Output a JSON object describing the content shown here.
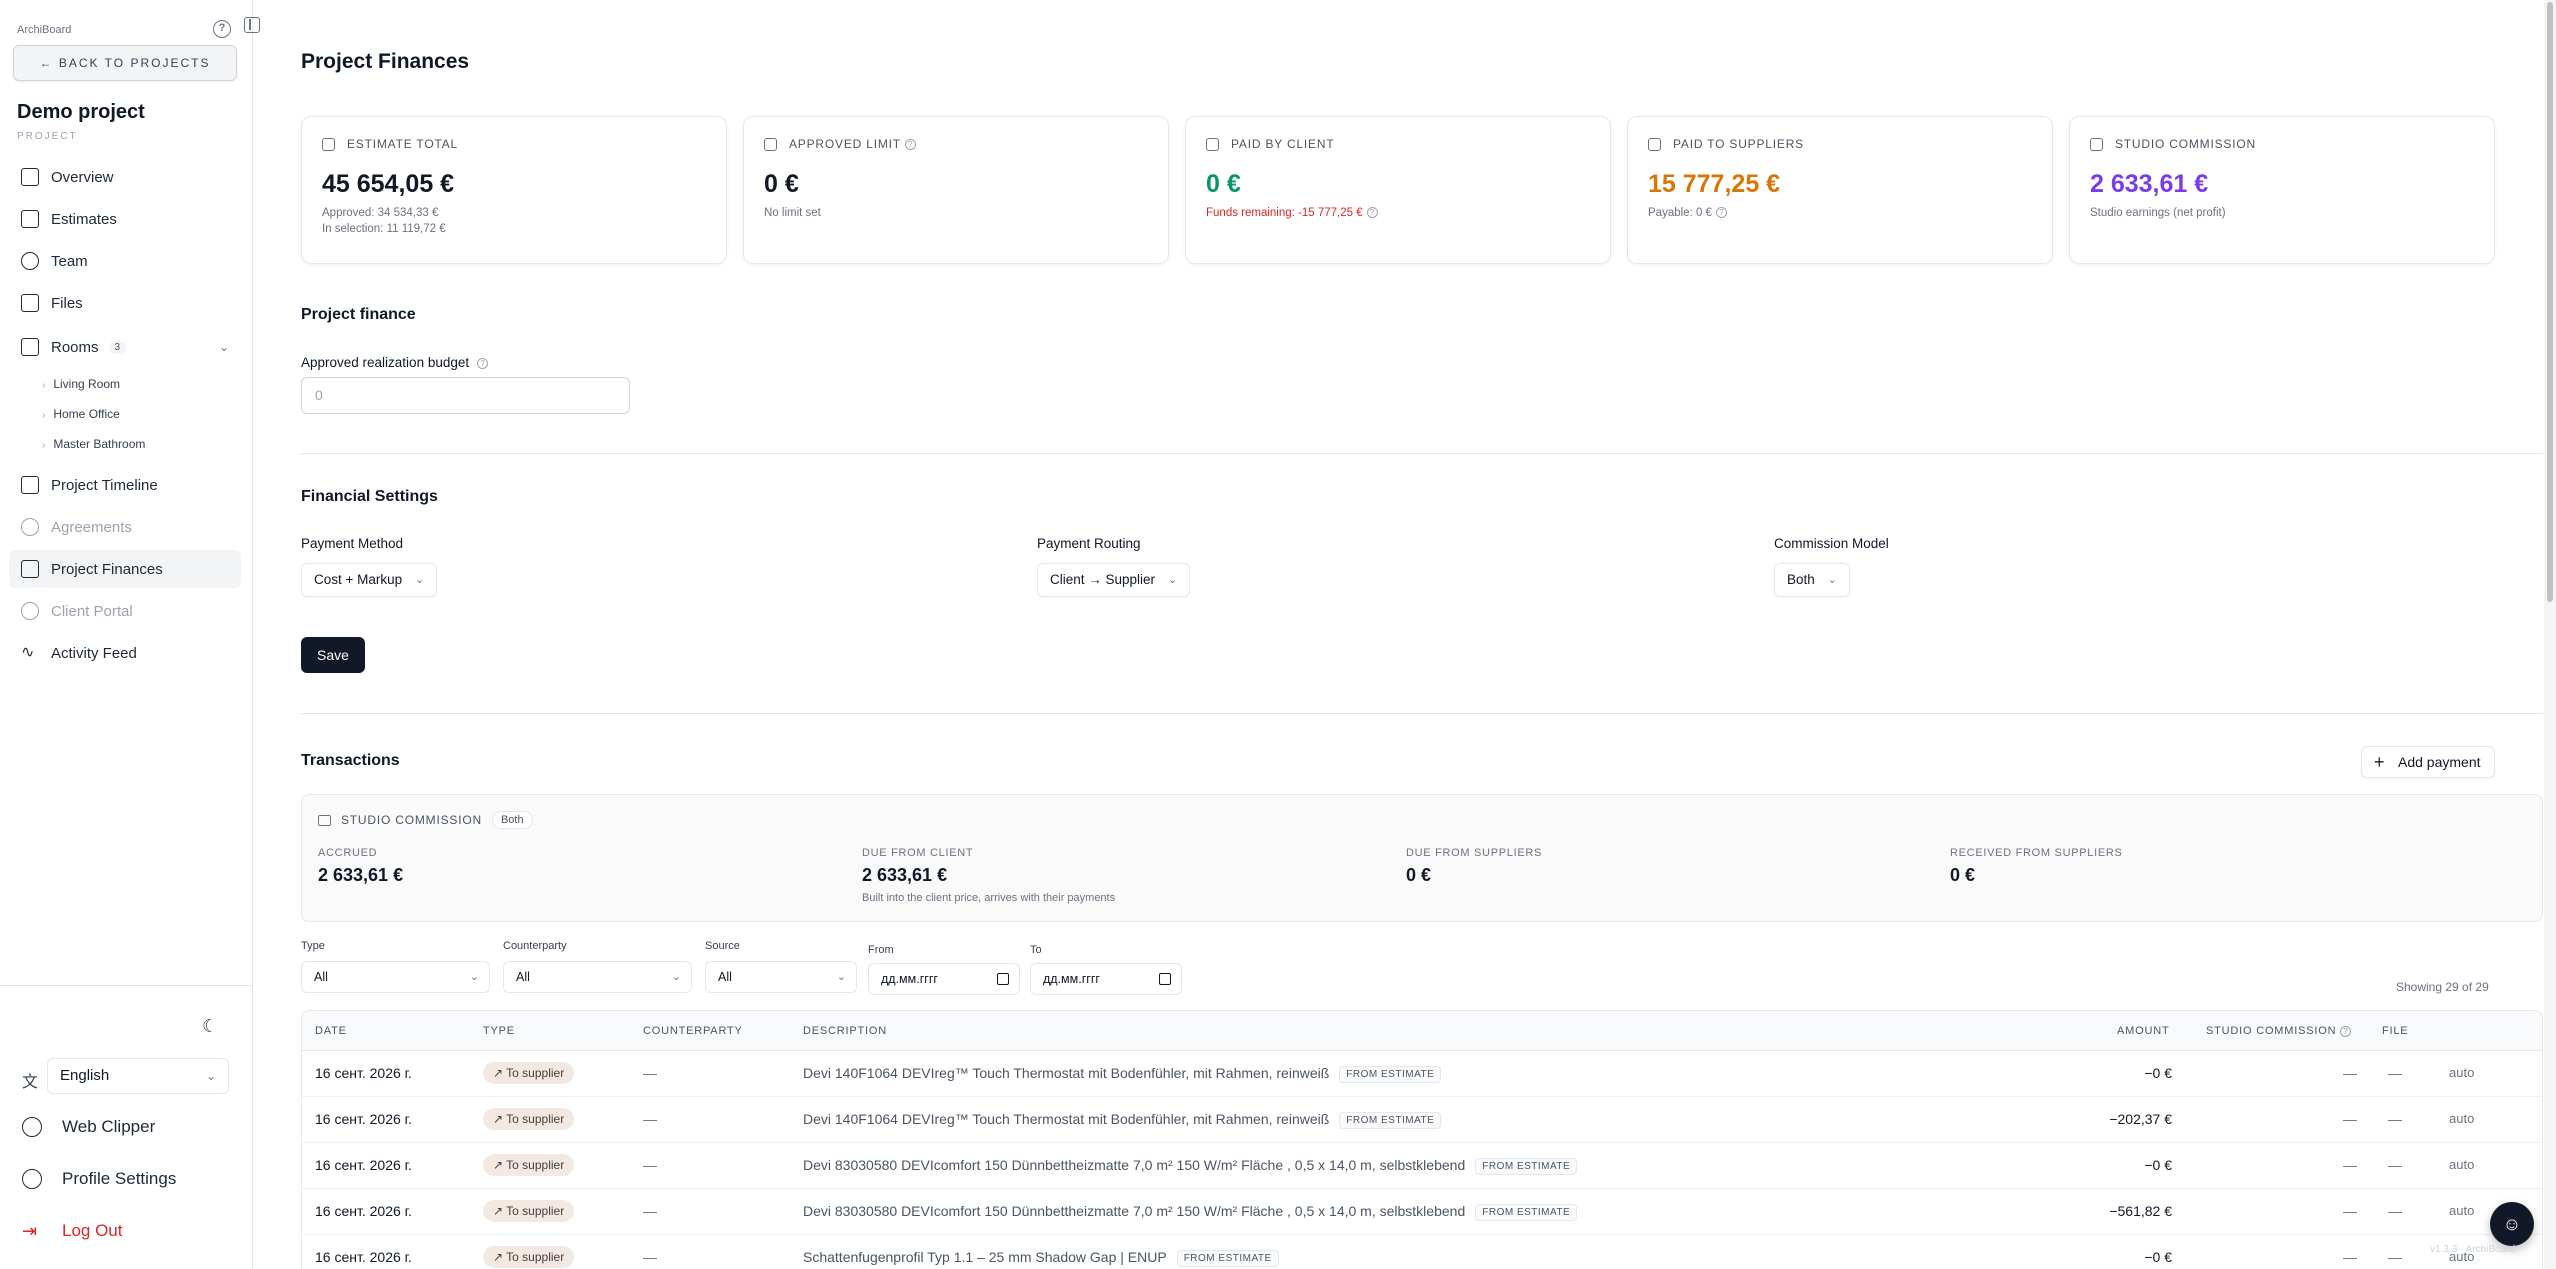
{
  "sidebar": {
    "brand": "ArchiBoard",
    "back_label": "← BACK TO PROJECTS",
    "project_name": "Demo project",
    "project_label": "PROJECT",
    "nav": [
      {
        "label": "Overview",
        "icon": "grid-icon"
      },
      {
        "label": "Estimates",
        "icon": "document-icon"
      },
      {
        "label": "Team",
        "icon": "users-icon"
      },
      {
        "label": "Files",
        "icon": "folder-icon"
      },
      {
        "label": "Rooms",
        "icon": "home-icon",
        "count": "3"
      },
      {
        "label": "Project Timeline",
        "icon": "calendar-icon"
      },
      {
        "label": "Agreements",
        "icon": "handshake-icon"
      },
      {
        "label": "Project Finances",
        "icon": "finance-icon"
      },
      {
        "label": "Client Portal",
        "icon": "share-icon"
      },
      {
        "label": "Activity Feed",
        "icon": "activity-icon"
      }
    ],
    "rooms": [
      "Living Room",
      "Home Office",
      "Master Bathroom"
    ],
    "language": "English",
    "web_clipper": "Web Clipper",
    "profile_settings": "Profile Settings",
    "logout": "Log Out"
  },
  "page": {
    "title": "Project Finances"
  },
  "cards": [
    {
      "label": "ESTIMATE TOTAL",
      "value": "45 654,05 €",
      "sub1": "Approved: 34 534,33 €",
      "sub2": "In selection: 11 119,72 €"
    },
    {
      "label": "APPROVED LIMIT",
      "value": "0 €",
      "sub1": "No limit set"
    },
    {
      "label": "PAID BY CLIENT",
      "value": "0 €",
      "sub1": "Funds remaining: -15 777,25 €"
    },
    {
      "label": "PAID TO SUPPLIERS",
      "value": "15 777,25 €",
      "sub1": "Payable: 0 €"
    },
    {
      "label": "STUDIO COMMISSION",
      "value": "2 633,61 €",
      "sub1": "Studio earnings (net profit)"
    }
  ],
  "project_finance": {
    "heading": "Project finance",
    "budget_label": "Approved realization budget",
    "budget_placeholder": "0"
  },
  "financial_settings": {
    "heading": "Financial Settings",
    "payment_method_label": "Payment Method",
    "payment_method_value": "Cost + Markup",
    "payment_routing_label": "Payment Routing",
    "payment_routing_value": "Client → Supplier",
    "commission_model_label": "Commission Model",
    "commission_model_value": "Both",
    "save_label": "Save"
  },
  "transactions": {
    "heading": "Transactions",
    "add_payment_label": "Add payment",
    "commission": {
      "title": "STUDIO COMMISSION",
      "badge": "Both",
      "accrued_label": "ACCRUED",
      "accrued_value": "2 633,61 €",
      "due_client_label": "DUE FROM CLIENT",
      "due_client_value": "2 633,61 €",
      "due_client_note": "Built into the client price, arrives with their payments",
      "due_suppliers_label": "DUE FROM SUPPLIERS",
      "due_suppliers_value": "0 €",
      "received_label": "RECEIVED FROM SUPPLIERS",
      "received_value": "0 €"
    },
    "filters": {
      "type_label": "Type",
      "type_value": "All",
      "counterparty_label": "Counterparty",
      "counterparty_value": "All",
      "source_label": "Source",
      "source_value": "All",
      "from_label": "From",
      "from_value": "дд.мм.гггг",
      "to_label": "To",
      "to_value": "дд.мм.гггг"
    },
    "showing": "Showing 29 of 29",
    "columns": [
      "DATE",
      "TYPE",
      "COUNTERPARTY",
      "DESCRIPTION",
      "AMOUNT",
      "STUDIO COMMISSION",
      "FILE"
    ],
    "rows": [
      {
        "date": "16 сент. 2026 г.",
        "type": "↗ To supplier",
        "counterparty": "—",
        "description": "Devi 140F1064 DEVIreg™ Touch Thermostat mit Bodenfühler, mit Rahmen, reinweiß",
        "tag": "FROM ESTIMATE",
        "amount": "−0 €",
        "commission": "—",
        "file": "—",
        "source": "auto"
      },
      {
        "date": "16 сент. 2026 г.",
        "type": "↗ To supplier",
        "counterparty": "—",
        "description": "Devi 140F1064 DEVIreg™ Touch Thermostat mit Bodenfühler, mit Rahmen, reinweiß",
        "tag": "FROM ESTIMATE",
        "amount": "−202,37 €",
        "commission": "—",
        "file": "—",
        "source": "auto"
      },
      {
        "date": "16 сент. 2026 г.",
        "type": "↗ To supplier",
        "counterparty": "—",
        "description": "Devi 83030580 DEVIcomfort 150 Dünnbettheizmatte 7,0 m² 150 W/m² Fläche , 0,5 x 14,0 m, selbstklebend",
        "tag": "FROM ESTIMATE",
        "amount": "−0 €",
        "commission": "—",
        "file": "—",
        "source": "auto"
      },
      {
        "date": "16 сент. 2026 г.",
        "type": "↗ To supplier",
        "counterparty": "—",
        "description": "Devi 83030580 DEVIcomfort 150 Dünnbettheizmatte 7,0 m² 150 W/m² Fläche , 0,5 x 14,0 m, selbstklebend",
        "tag": "FROM ESTIMATE",
        "amount": "−561,82 €",
        "commission": "—",
        "file": "—",
        "source": "auto"
      },
      {
        "date": "16 сент. 2026 г.",
        "type": "↗ To supplier",
        "counterparty": "—",
        "description": "Schattenfugenprofil Typ 1.1 – 25 mm Shadow Gap | ENUP",
        "tag": "FROM ESTIMATE",
        "amount": "−0 €",
        "commission": "—",
        "file": "—",
        "source": "auto"
      }
    ]
  },
  "footer": {
    "version": "v1.3.3 · ArchiBoard"
  }
}
